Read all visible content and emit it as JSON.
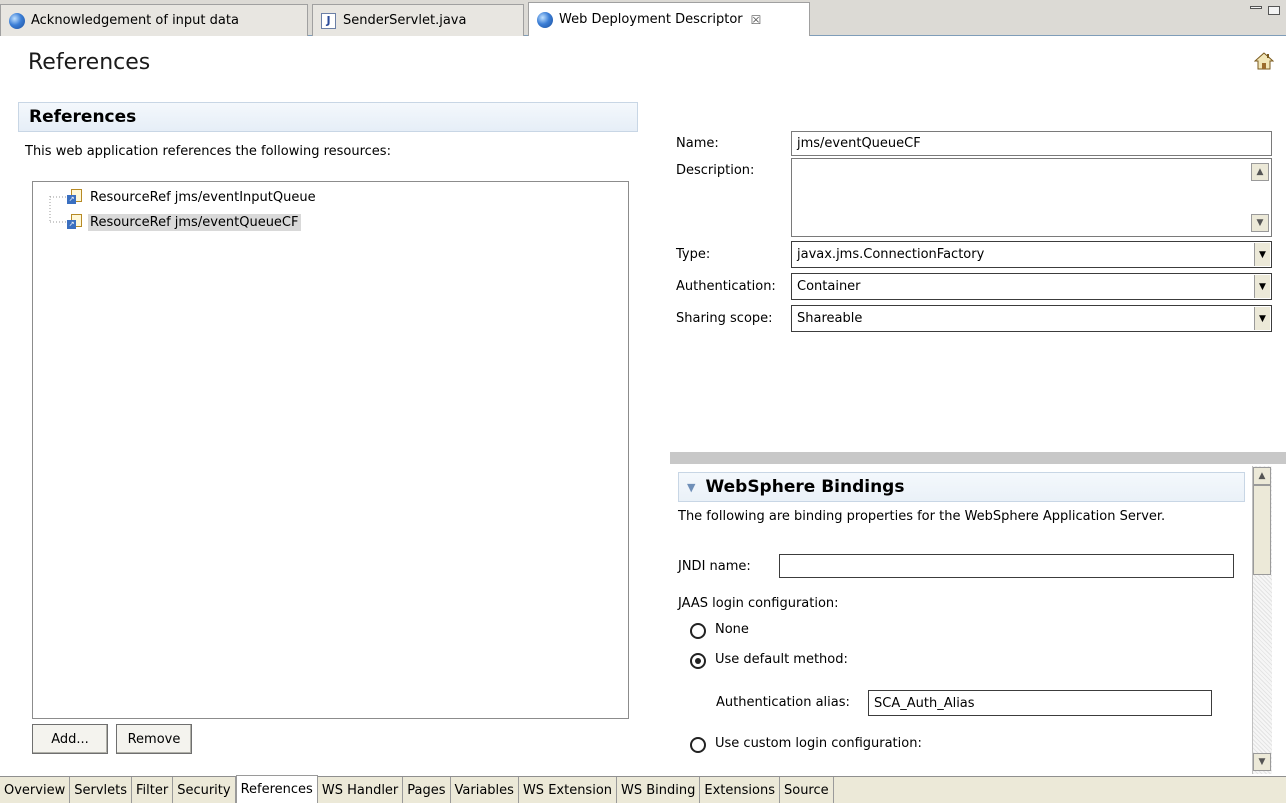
{
  "editor_tabs": [
    {
      "label": "Acknowledgement of input data",
      "icon": "globe-icon"
    },
    {
      "label": "SenderServlet.java",
      "icon": "java-file-icon"
    },
    {
      "label": "Web Deployment Descriptor",
      "icon": "globe-icon",
      "close": "☒"
    }
  ],
  "page_title": "References",
  "section": {
    "title": "References",
    "description": "This web application references the following resources:"
  },
  "tree_items": [
    {
      "label": "ResourceRef jms/eventInputQueue",
      "selected": false
    },
    {
      "label": "ResourceRef jms/eventQueueCF",
      "selected": true
    }
  ],
  "buttons": {
    "add": "Add...",
    "remove": "Remove"
  },
  "details": {
    "name_label": "Name:",
    "name_value": "jms/eventQueueCF",
    "description_label": "Description:",
    "description_value": "",
    "type_label": "Type:",
    "type_value": "javax.jms.ConnectionFactory",
    "auth_label": "Authentication:",
    "auth_value": "Container",
    "sharing_label": "Sharing scope:",
    "sharing_value": "Shareable"
  },
  "bindings": {
    "title": "WebSphere Bindings",
    "description": "The following are binding properties for the WebSphere Application Server.",
    "jndi_label": "JNDI name:",
    "jndi_value": "",
    "jaas_label": "JAAS login configuration:",
    "radio_none": "None",
    "radio_default": "Use default method:",
    "selected_radio": "default",
    "alias_label": "Authentication alias:",
    "alias_value": "SCA_Auth_Alias",
    "radio_custom": "Use custom login configuration:"
  },
  "page_tabs": [
    "Overview",
    "Servlets",
    "Filter",
    "Security",
    "References",
    "WS Handler",
    "Pages",
    "Variables",
    "WS Extension",
    "WS Binding",
    "Extensions",
    "Source"
  ],
  "active_page_tab": "References",
  "colors": {
    "section_header_border": "#c8d6e5",
    "selection": "#d9d9d9",
    "toolbar": "#ece9d8"
  }
}
